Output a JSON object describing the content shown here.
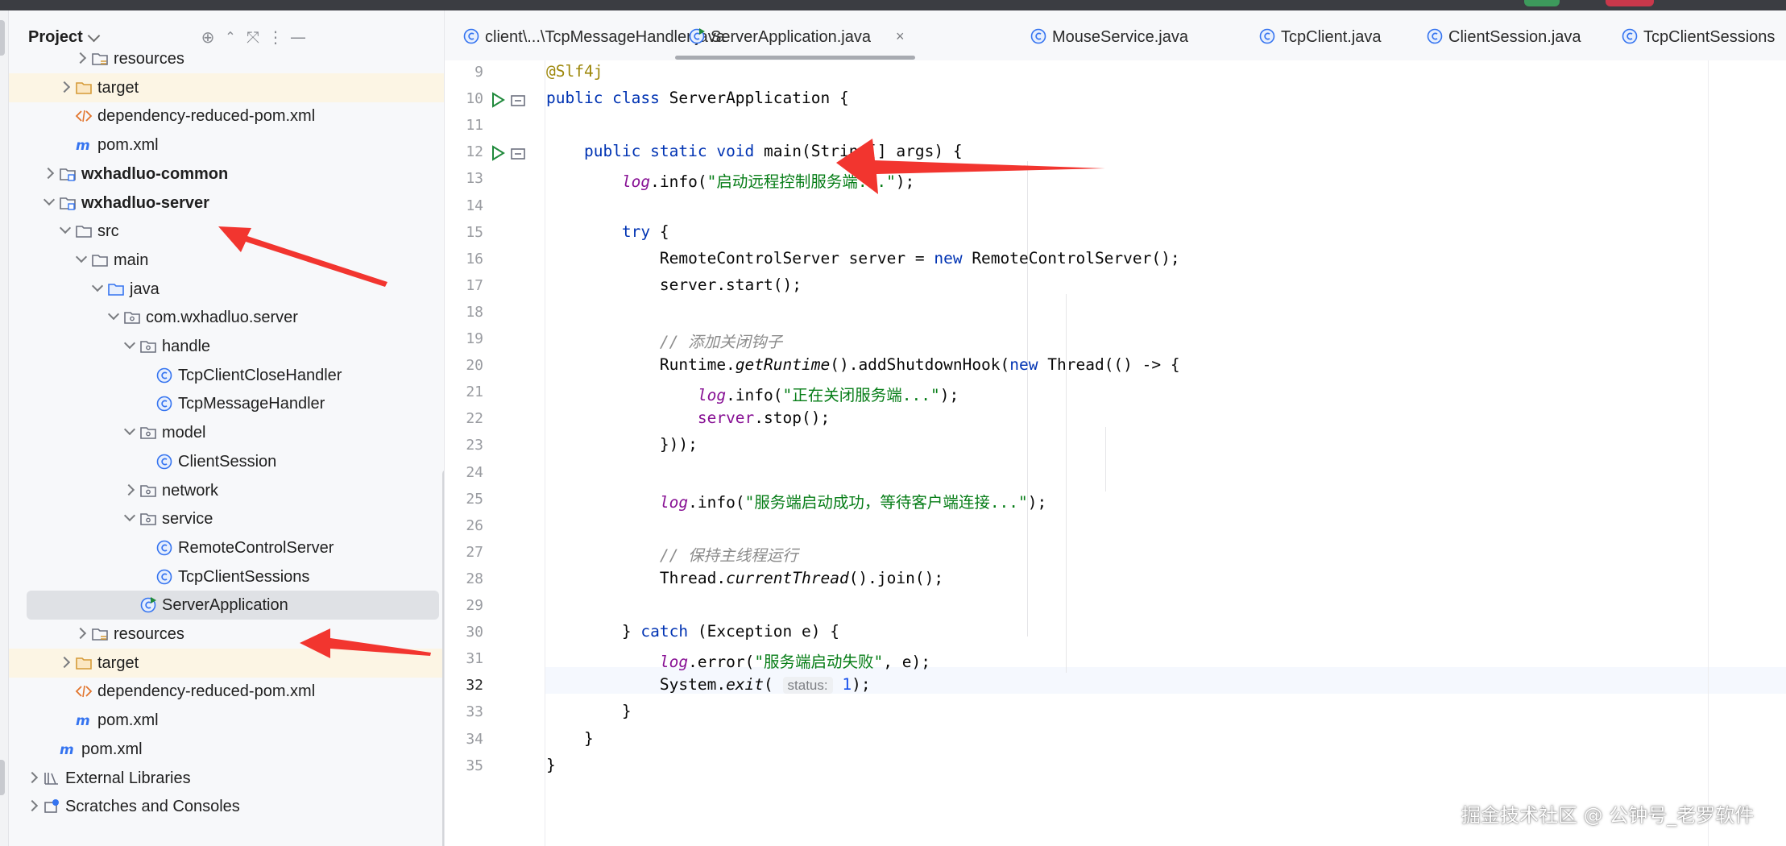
{
  "project_panel": {
    "title": "Project",
    "tree": [
      {
        "label": "resources",
        "icon": "resources-folder-icon",
        "depth": 4,
        "arrow": "right"
      },
      {
        "label": "target",
        "icon": "folder-orange-icon",
        "depth": 3,
        "arrow": "right",
        "highlight": true
      },
      {
        "label": "dependency-reduced-pom.xml",
        "icon": "xml-file-icon",
        "depth": 3,
        "arrow": "none"
      },
      {
        "label": "pom.xml",
        "icon": "maven-file-icon",
        "depth": 3,
        "arrow": "none"
      },
      {
        "label": "wxhadluo-common",
        "icon": "module-folder-icon",
        "depth": 2,
        "arrow": "right",
        "bold": true
      },
      {
        "label": "wxhadluo-server",
        "icon": "module-folder-icon",
        "depth": 2,
        "arrow": "down",
        "bold": true
      },
      {
        "label": "src",
        "icon": "folder-icon",
        "depth": 3,
        "arrow": "down"
      },
      {
        "label": "main",
        "icon": "folder-icon",
        "depth": 4,
        "arrow": "down"
      },
      {
        "label": "java",
        "icon": "source-folder-icon",
        "depth": 5,
        "arrow": "down"
      },
      {
        "label": "com.wxhadluo.server",
        "icon": "package-icon",
        "depth": 6,
        "arrow": "down"
      },
      {
        "label": "handle",
        "icon": "package-icon",
        "depth": 7,
        "arrow": "down"
      },
      {
        "label": "TcpClientCloseHandler",
        "icon": "class-icon",
        "depth": 8,
        "arrow": "none"
      },
      {
        "label": "TcpMessageHandler",
        "icon": "class-icon",
        "depth": 8,
        "arrow": "none"
      },
      {
        "label": "model",
        "icon": "package-icon",
        "depth": 7,
        "arrow": "down"
      },
      {
        "label": "ClientSession",
        "icon": "class-icon",
        "depth": 8,
        "arrow": "none"
      },
      {
        "label": "network",
        "icon": "package-icon",
        "depth": 7,
        "arrow": "right"
      },
      {
        "label": "service",
        "icon": "package-icon",
        "depth": 7,
        "arrow": "down"
      },
      {
        "label": "RemoteControlServer",
        "icon": "class-icon",
        "depth": 8,
        "arrow": "none"
      },
      {
        "label": "TcpClientSessions",
        "icon": "class-icon",
        "depth": 8,
        "arrow": "none"
      },
      {
        "label": "ServerApplication",
        "icon": "runnable-class-icon",
        "depth": 7,
        "arrow": "none",
        "selected": true
      },
      {
        "label": "resources",
        "icon": "resources-folder-icon",
        "depth": 4,
        "arrow": "right"
      },
      {
        "label": "target",
        "icon": "folder-orange-icon",
        "depth": 3,
        "arrow": "right",
        "highlight": true
      },
      {
        "label": "dependency-reduced-pom.xml",
        "icon": "xml-file-icon",
        "depth": 3,
        "arrow": "none"
      },
      {
        "label": "pom.xml",
        "icon": "maven-file-icon",
        "depth": 3,
        "arrow": "none"
      },
      {
        "label": "pom.xml",
        "icon": "maven-file-icon",
        "depth": 2,
        "arrow": "none"
      },
      {
        "label": "External Libraries",
        "icon": "library-icon",
        "depth": 1,
        "arrow": "right"
      },
      {
        "label": "Scratches and Consoles",
        "icon": "scratches-icon",
        "depth": 1,
        "arrow": "right"
      }
    ]
  },
  "tabs": [
    {
      "label": "client\\...\\TcpMessageHandler.java",
      "icon": "class-icon",
      "active": false
    },
    {
      "label": "ServerApplication.java",
      "icon": "runnable-class-icon",
      "active": true,
      "close": "×"
    },
    {
      "label": "MouseService.java",
      "icon": "class-icon",
      "active": false
    },
    {
      "label": "TcpClient.java",
      "icon": "class-icon",
      "active": false
    },
    {
      "label": "ClientSession.java",
      "icon": "class-icon",
      "active": false
    },
    {
      "label": "TcpClientSessions",
      "icon": "class-icon",
      "active": false
    }
  ],
  "editor": {
    "current_line": 32,
    "lines": [
      {
        "n": "9",
        "html": "<span class=\"ann\">@Slf4j</span>"
      },
      {
        "n": "10",
        "html": "<span class=\"kw\">public class</span> ServerApplication {",
        "run": true
      },
      {
        "n": "11",
        "html": ""
      },
      {
        "n": "12",
        "html": "    <span class=\"kw\">public static void</span> main(String[] args) {",
        "run": true
      },
      {
        "n": "13",
        "html": "        <span class=\"fld it\">log</span>.info(<span class=\"str\">\"启动远程控制服务端...\"</span>);"
      },
      {
        "n": "14",
        "html": ""
      },
      {
        "n": "15",
        "html": "        <span class=\"kw\">try</span> {"
      },
      {
        "n": "16",
        "html": "            RemoteControlServer server = <span class=\"kw\">new</span> RemoteControlServer();"
      },
      {
        "n": "17",
        "html": "            server.start();"
      },
      {
        "n": "18",
        "html": ""
      },
      {
        "n": "19",
        "html": "            <span class=\"cm\">// 添加关闭钩子</span>"
      },
      {
        "n": "20",
        "html": "            Runtime.<span class=\"it\">getRuntime</span>().addShutdownHook(<span class=\"kw\">new</span> Thread(() -> {"
      },
      {
        "n": "21",
        "html": "                <span class=\"fld it\">log</span>.info(<span class=\"str\">\"正在关闭服务端...\"</span>);"
      },
      {
        "n": "22",
        "html": "                <span class=\"fld\">server</span>.stop();"
      },
      {
        "n": "23",
        "html": "            }));"
      },
      {
        "n": "24",
        "html": ""
      },
      {
        "n": "25",
        "html": "            <span class=\"fld it\">log</span>.info(<span class=\"str\">\"服务端启动成功，等待客户端连接...\"</span>);"
      },
      {
        "n": "26",
        "html": ""
      },
      {
        "n": "27",
        "html": "            <span class=\"cm\">// 保持主线程运行</span>"
      },
      {
        "n": "28",
        "html": "            Thread.<span class=\"it\">currentThread</span>().join();"
      },
      {
        "n": "29",
        "html": ""
      },
      {
        "n": "30",
        "html": "        } <span class=\"kw\">catch</span> (Exception e) {"
      },
      {
        "n": "31",
        "html": "            <span class=\"fld it\">log</span>.error(<span class=\"str\">\"服务端启动失败\"</span>, e);"
      },
      {
        "n": "32",
        "html": "            System.<span class=\"it\">exit</span>( <span class=\"hint\">status:</span> <span class=\"num\">1</span>);"
      },
      {
        "n": "33",
        "html": "        }"
      },
      {
        "n": "34",
        "html": "    }"
      },
      {
        "n": "35",
        "html": "}"
      }
    ]
  },
  "watermark": "掘金技术社区 @ 公钟号_老罗软件",
  "colors": {
    "annotation_arrow": "#f2352f",
    "keyword": "#0033b3",
    "string": "#067d17"
  }
}
